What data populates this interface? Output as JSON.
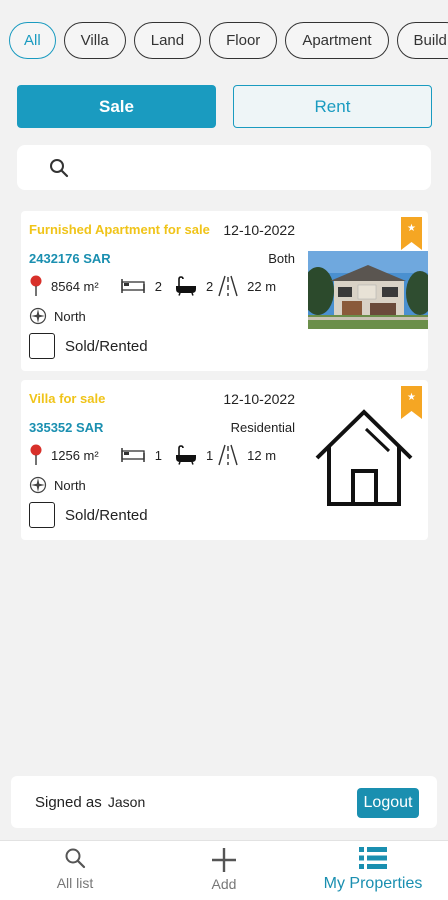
{
  "filters": [
    "All",
    "Villa",
    "Land",
    "Floor",
    "Apartment",
    "Build"
  ],
  "segments": {
    "sale": "Sale",
    "rent": "Rent"
  },
  "search": {
    "placeholder": ""
  },
  "listings": [
    {
      "title": "Furnished Apartment for sale",
      "date": "12-10-2022",
      "price": "2432176 SAR",
      "type": "Both",
      "area": "8564 m²",
      "bedrooms": "2",
      "bathrooms": "2",
      "street_width": "22 m",
      "direction": "North",
      "sold_label": "Sold/Rented"
    },
    {
      "title": "Villa for sale",
      "date": "12-10-2022",
      "price": "335352 SAR",
      "type": "Residential",
      "area": "1256 m²",
      "bedrooms": "1",
      "bathrooms": "1",
      "street_width": "12 m",
      "direction": "North",
      "sold_label": "Sold/Rented"
    }
  ],
  "user": {
    "signed_label": "Signed as",
    "name": "Jason",
    "logout": "Logout"
  },
  "nav": {
    "all": "All list",
    "add": "Add",
    "mine": "My Properties"
  },
  "colors": {
    "accent": "#1a9bc0",
    "title_yellow": "#f0c419",
    "bookmark": "#f5a623"
  }
}
